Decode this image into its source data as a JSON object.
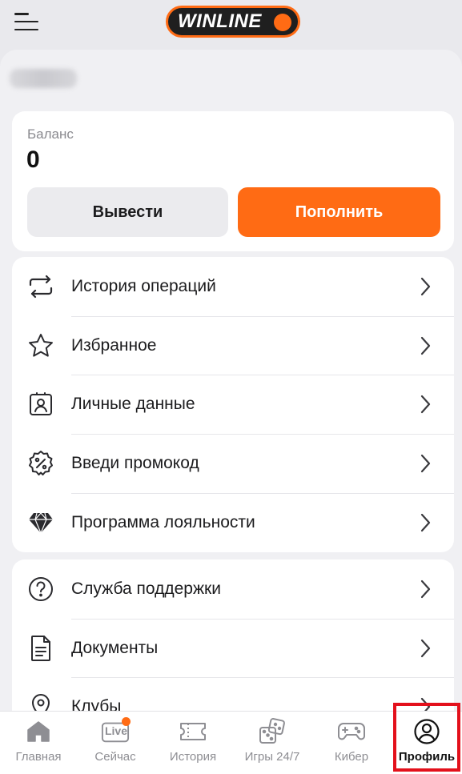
{
  "header": {
    "logo_text": "WINLINE",
    "menu_icon": "hamburger-menu-icon"
  },
  "balance": {
    "label": "Баланс",
    "value": "0",
    "withdraw_label": "Вывести",
    "deposit_label": "Пополнить"
  },
  "menu_primary": [
    {
      "label": "История операций",
      "icon": "transfer-arrows-icon"
    },
    {
      "label": "Избранное",
      "icon": "star-icon"
    },
    {
      "label": "Личные данные",
      "icon": "id-card-icon"
    },
    {
      "label": "Введи промокод",
      "icon": "percent-badge-icon"
    },
    {
      "label": "Программа лояльности",
      "icon": "diamond-icon"
    }
  ],
  "menu_secondary": [
    {
      "label": "Служба поддержки",
      "icon": "question-circle-icon"
    },
    {
      "label": "Документы",
      "icon": "document-icon"
    },
    {
      "label": "Клубы",
      "icon": "map-pin-icon"
    }
  ],
  "bottom_nav": [
    {
      "label": "Главная",
      "icon": "home-icon"
    },
    {
      "label": "Сейчас",
      "icon": "live-icon",
      "badge_text": "Live"
    },
    {
      "label": "История",
      "icon": "ticket-icon"
    },
    {
      "label": "Игры 24/7",
      "icon": "dice-icon"
    },
    {
      "label": "Кибер",
      "icon": "gamepad-icon"
    },
    {
      "label": "Профиль",
      "icon": "user-circle-icon",
      "active": true
    }
  ],
  "colors": {
    "accent": "#ff6b14",
    "highlight": "#e3101b",
    "background": "#f0f0f3"
  }
}
